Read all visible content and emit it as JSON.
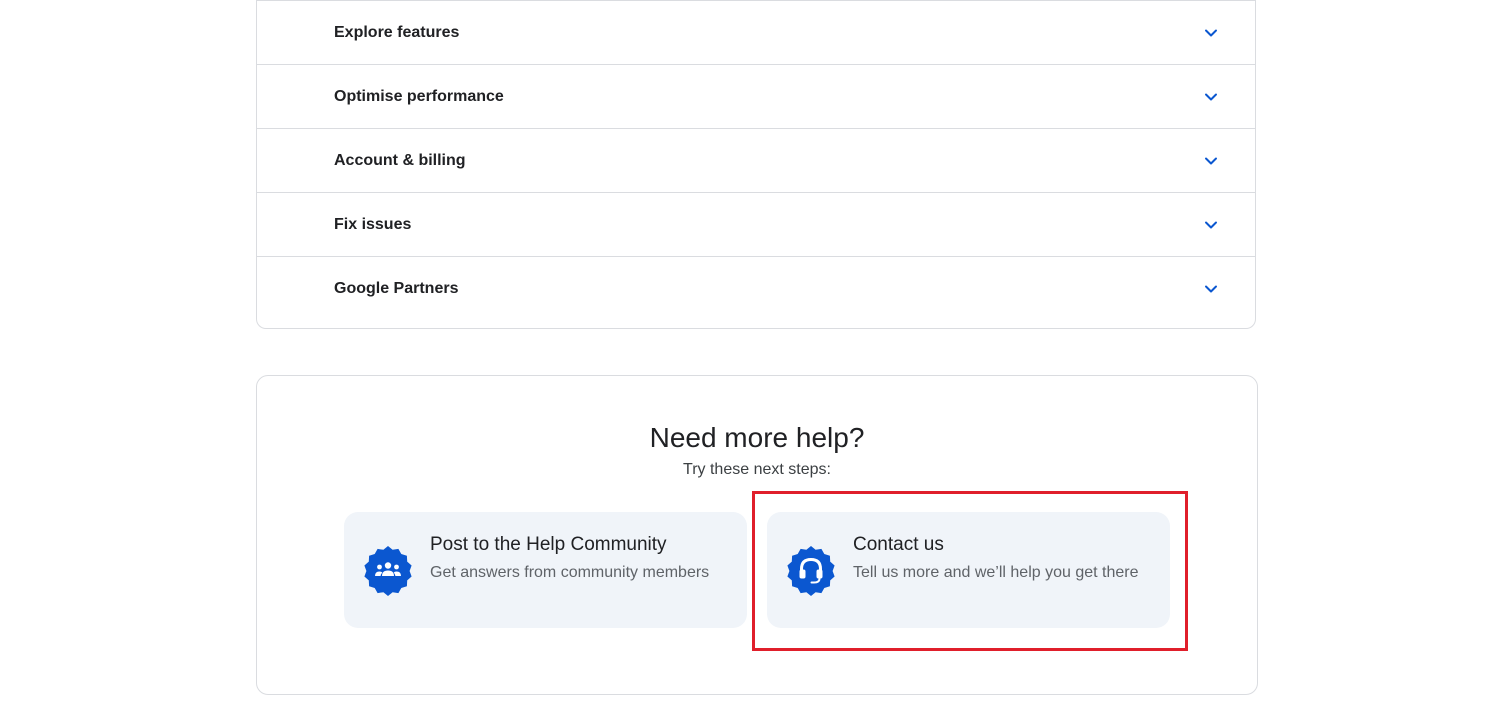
{
  "accordion": {
    "items": [
      {
        "label": "Explore features",
        "icon": "chevron-down-icon"
      },
      {
        "label": "Optimise performance",
        "icon": "chevron-down-icon"
      },
      {
        "label": "Account & billing",
        "icon": "chevron-down-icon"
      },
      {
        "label": "Fix issues",
        "icon": "chevron-down-icon"
      },
      {
        "label": "Google Partners",
        "icon": "chevron-down-icon"
      }
    ]
  },
  "help": {
    "title": "Need more help?",
    "subtitle": "Try these next steps:",
    "options": [
      {
        "title": "Post to the Help Community",
        "description": "Get answers from community members",
        "icon": "community-icon"
      },
      {
        "title": "Contact us",
        "description": "Tell us more and we’ll help you get there",
        "icon": "headset-icon"
      }
    ]
  },
  "colors": {
    "accent": "#0b57d0",
    "card_bg": "#f0f4f9",
    "border": "#dadce0",
    "highlight": "#e01f2b"
  }
}
